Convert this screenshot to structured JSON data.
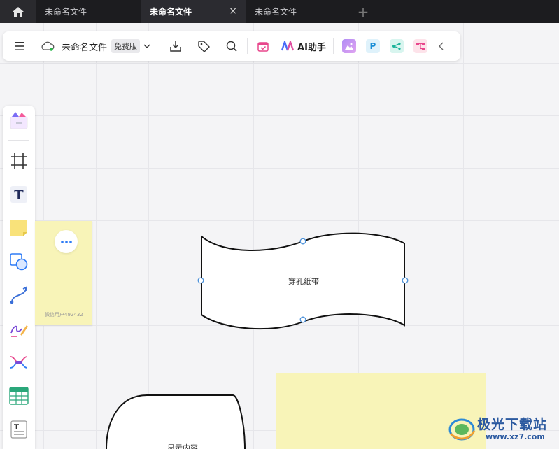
{
  "tabs": [
    {
      "label": "未命名文件",
      "active": false
    },
    {
      "label": "未命名文件",
      "active": true
    },
    {
      "label": "未命名文件",
      "active": false
    }
  ],
  "tab_close_glyph": "×",
  "tab_add_glyph": "+",
  "toolbar": {
    "filename": "未命名文件",
    "plan_badge": "免费版",
    "ai_label": "AI助手",
    "app_p_label": "P"
  },
  "canvas": {
    "sticky_note_author": "微信用户492432",
    "tape_shape_label": "穿孔纸带",
    "display_shape_label": "显示内容"
  },
  "lefttool_text_letter": "T",
  "watermark": {
    "title": "极光下载站",
    "url": "www.xz7.com"
  },
  "colors": {
    "tabbar_bg": "#1c1c1f",
    "sticky_yellow": "#f8f4b8",
    "selection_handle": "#4a90d9"
  }
}
